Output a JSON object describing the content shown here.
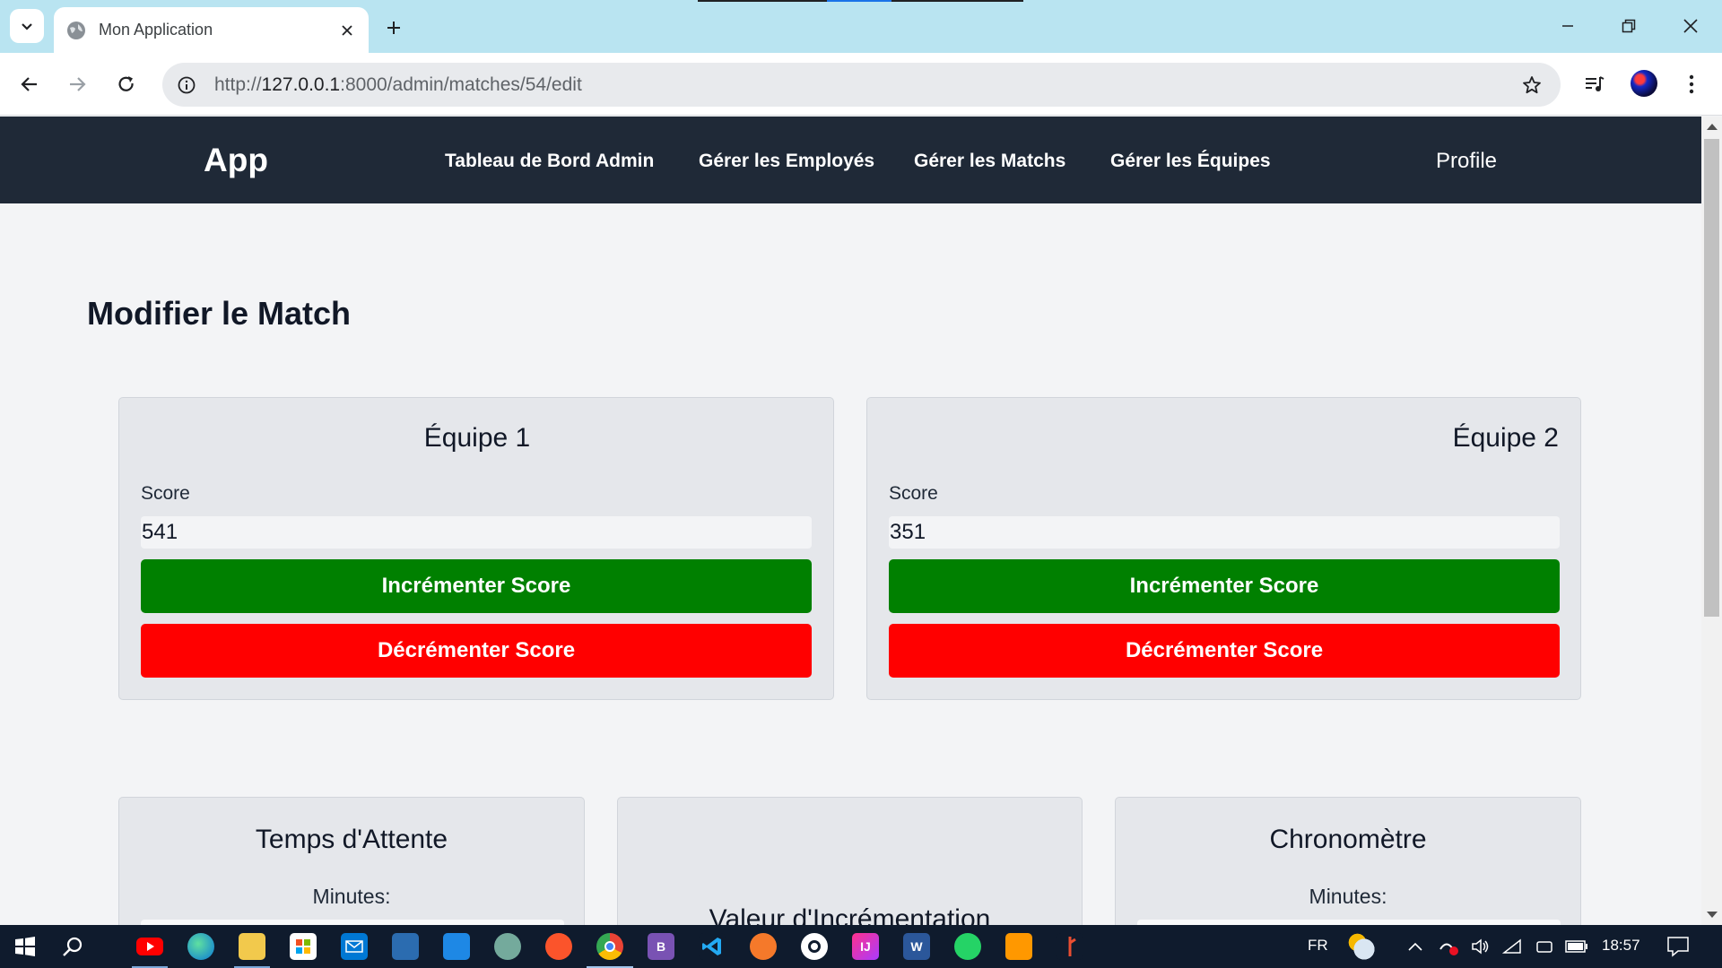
{
  "browser": {
    "tab_title": "Mon Application",
    "url_prefix": "http://",
    "url_host": "127.0.0.1",
    "url_path": ":8000/admin/matches/54/edit"
  },
  "nav": {
    "brand": "App",
    "links": [
      "Tableau de Bord Admin",
      "Gérer les Employés",
      "Gérer les Matchs",
      "Gérer les Équipes"
    ],
    "profile": "Profile"
  },
  "page": {
    "title": "Modifier le Match"
  },
  "teams": [
    {
      "name": "Équipe 1",
      "score_label": "Score",
      "score": "541",
      "increment_label": "Incrémenter Score",
      "decrement_label": "Décrémenter Score"
    },
    {
      "name": "Équipe 2",
      "score_label": "Score",
      "score": "351",
      "increment_label": "Incrémenter Score",
      "decrement_label": "Décrémenter Score"
    }
  ],
  "panels": {
    "wait_time": {
      "title": "Temps d'Attente",
      "minutes_label": "Minutes:"
    },
    "increment_value": {
      "title": "Valeur d'Incrémentation"
    },
    "timer": {
      "title": "Chronomètre",
      "minutes_label": "Minutes:"
    }
  },
  "colors": {
    "navbar": "#1f2937",
    "increment_button": "#008000",
    "decrement_button": "#ff0000",
    "tabstrip": "#b9e4f1"
  },
  "taskbar": {
    "language": "FR",
    "time": "18:57",
    "apps": [
      "youtube",
      "edge",
      "file-explorer",
      "store",
      "mail",
      "terminal",
      "app",
      "chatgpt",
      "brave",
      "chrome",
      "bootstrap",
      "vscode",
      "blender",
      "openai",
      "intellij",
      "word",
      "whatsapp",
      "sublime",
      "git"
    ]
  }
}
